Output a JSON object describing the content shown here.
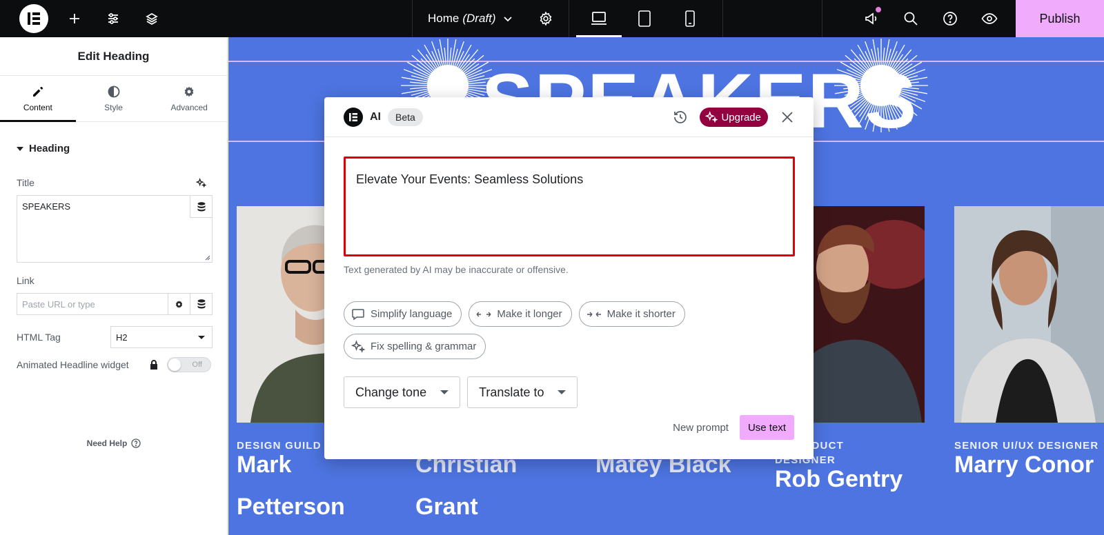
{
  "topbar": {
    "page_name": "Home",
    "page_status": "(Draft)",
    "publish_label": "Publish"
  },
  "panel": {
    "title": "Edit Heading",
    "tabs": [
      {
        "label": "Content"
      },
      {
        "label": "Style"
      },
      {
        "label": "Advanced"
      }
    ],
    "section_heading": "Heading",
    "title_label": "Title",
    "title_value": "SPEAKERS",
    "link_label": "Link",
    "link_placeholder": "Paste URL or type",
    "html_tag_label": "HTML Tag",
    "html_tag_value": "H2",
    "animated_label": "Animated Headline widget",
    "toggle_text": "Off",
    "need_help": "Need Help"
  },
  "canvas": {
    "heading": "SPEAKERS",
    "speakers": [
      {
        "role": "DESIGN GUILD",
        "name_line1": "Mark",
        "name_line2": "Petterson"
      },
      {
        "role": "",
        "name_line1": "Christian",
        "name_line2": "Grant"
      },
      {
        "role": "",
        "name_line1": "Matey Black",
        "name_line2": ""
      },
      {
        "role_line1": "R PRODUCT",
        "role_line2": "DESIGNER",
        "name_line1": "Rob Gentry"
      },
      {
        "role": "SENIOR UI/UX DESIGNER",
        "name_line1": "Marry Conor"
      }
    ]
  },
  "ai_modal": {
    "ai_label": "AI",
    "beta_label": "Beta",
    "upgrade_label": "Upgrade",
    "result_text": "Elevate Your Events: Seamless Solutions",
    "disclaimer": "Text generated by AI may be inaccurate or offensive.",
    "chips": [
      {
        "label": "Simplify language",
        "icon": "speech-bubble-icon"
      },
      {
        "label": "Make it longer",
        "icon": "expand-arrows-icon"
      },
      {
        "label": "Make it shorter",
        "icon": "shrink-arrows-icon"
      },
      {
        "label": "Fix spelling & grammar",
        "icon": "sparkle-icon"
      }
    ],
    "change_tone_label": "Change tone",
    "translate_label": "Translate to",
    "new_prompt_label": "New prompt",
    "use_text_label": "Use text"
  },
  "colors": {
    "canvas_bg": "#4d74e0",
    "publish_bg": "#f0abfc",
    "upgrade_bg": "#93003f",
    "highlight_border": "#e00000"
  }
}
